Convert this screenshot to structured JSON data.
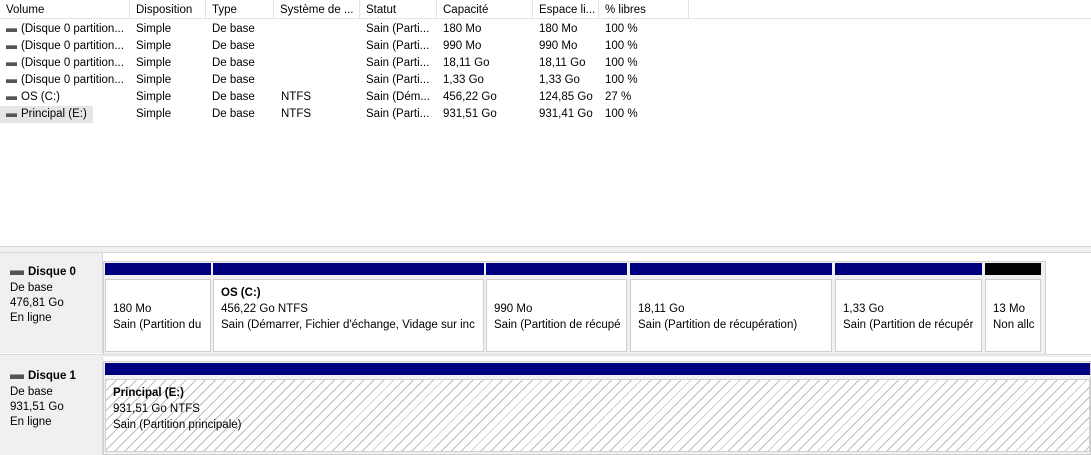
{
  "columns": [
    {
      "key": "volume",
      "label": "Volume"
    },
    {
      "key": "disposition",
      "label": "Disposition"
    },
    {
      "key": "type",
      "label": "Type"
    },
    {
      "key": "filesystem",
      "label": "Système de ..."
    },
    {
      "key": "status",
      "label": "Statut"
    },
    {
      "key": "capacity",
      "label": "Capacité"
    },
    {
      "key": "free",
      "label": "Espace li..."
    },
    {
      "key": "pct",
      "label": "% libres"
    }
  ],
  "volumes": [
    {
      "volume": "(Disque 0 partition...",
      "disposition": "Simple",
      "type": "De base",
      "filesystem": "",
      "status": "Sain (Parti...",
      "capacity": "180 Mo",
      "free": "180 Mo",
      "pct": "100 %",
      "selected": false
    },
    {
      "volume": "(Disque 0 partition...",
      "disposition": "Simple",
      "type": "De base",
      "filesystem": "",
      "status": "Sain (Parti...",
      "capacity": "990 Mo",
      "free": "990 Mo",
      "pct": "100 %",
      "selected": false
    },
    {
      "volume": "(Disque 0 partition...",
      "disposition": "Simple",
      "type": "De base",
      "filesystem": "",
      "status": "Sain (Parti...",
      "capacity": "18,11 Go",
      "free": "18,11 Go",
      "pct": "100 %",
      "selected": false
    },
    {
      "volume": "(Disque 0 partition...",
      "disposition": "Simple",
      "type": "De base",
      "filesystem": "",
      "status": "Sain (Parti...",
      "capacity": "1,33 Go",
      "free": "1,33 Go",
      "pct": "100 %",
      "selected": false
    },
    {
      "volume": "OS (C:)",
      "disposition": "Simple",
      "type": "De base",
      "filesystem": "NTFS",
      "status": "Sain (Dém...",
      "capacity": "456,22 Go",
      "free": "124,85 Go",
      "pct": "27 %",
      "selected": false
    },
    {
      "volume": "Principal (E:)",
      "disposition": "Simple",
      "type": "De base",
      "filesystem": "NTFS",
      "status": "Sain (Parti...",
      "capacity": "931,51 Go",
      "free": "931,41 Go",
      "pct": "100 %",
      "selected": true
    }
  ],
  "disks": [
    {
      "name": "Disque 0",
      "kind": "De base",
      "size": "476,81 Go",
      "state": "En ligne",
      "partitions": [
        {
          "name": "",
          "size": "180 Mo",
          "status": "Sain (Partition du",
          "bar": "blue",
          "hatched": false
        },
        {
          "name": "OS  (C:)",
          "size": "456,22 Go NTFS",
          "status": "Sain (Démarrer, Fichier d'échange, Vidage sur inc",
          "bar": "blue",
          "hatched": false
        },
        {
          "name": "",
          "size": "990 Mo",
          "status": "Sain (Partition de récupé",
          "bar": "blue",
          "hatched": false
        },
        {
          "name": "",
          "size": "18,11 Go",
          "status": "Sain (Partition de récupération)",
          "bar": "blue",
          "hatched": false
        },
        {
          "name": "",
          "size": "1,33 Go",
          "status": "Sain (Partition de récupér",
          "bar": "blue",
          "hatched": false
        },
        {
          "name": "",
          "size": "13 Mo",
          "status": "Non allc",
          "bar": "black",
          "hatched": false
        }
      ]
    },
    {
      "name": "Disque 1",
      "kind": "De base",
      "size": "931,51 Go",
      "state": "En ligne",
      "partitions": [
        {
          "name": "Principal  (E:)",
          "size": "931,51 Go NTFS",
          "status": "Sain (Partition principale)",
          "bar": "blue",
          "hatched": true
        }
      ]
    }
  ]
}
